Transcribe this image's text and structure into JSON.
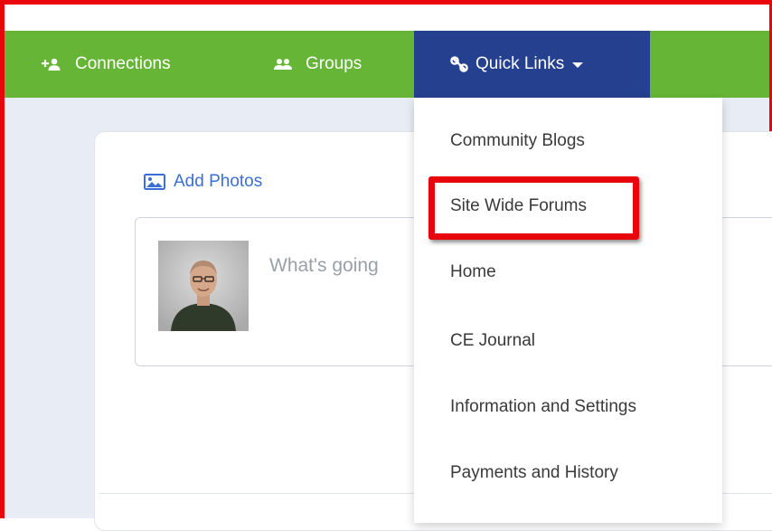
{
  "navbar": {
    "items": [
      {
        "label": "Connections",
        "icon": "add-connection-icon"
      },
      {
        "label": "Groups",
        "icon": "groups-icon"
      },
      {
        "label": "Quick Links",
        "icon": "link-icon",
        "active": true
      }
    ],
    "colors": {
      "bar": "#66b536",
      "active": "#25408f",
      "text": "#ffffff"
    }
  },
  "composer": {
    "add_photos_label": "Add Photos",
    "placeholder": "What's going"
  },
  "dropdown": {
    "items": [
      {
        "label": "Community Blogs"
      },
      {
        "label": "Site Wide Forums",
        "highlighted": true
      },
      {
        "label": "Home"
      },
      {
        "label": "CE Journal"
      },
      {
        "label": "Information and Settings"
      },
      {
        "label": "Payments and History"
      }
    ]
  },
  "annotation": {
    "highlight_color": "#e8050b",
    "border_color": "#e8050b"
  }
}
